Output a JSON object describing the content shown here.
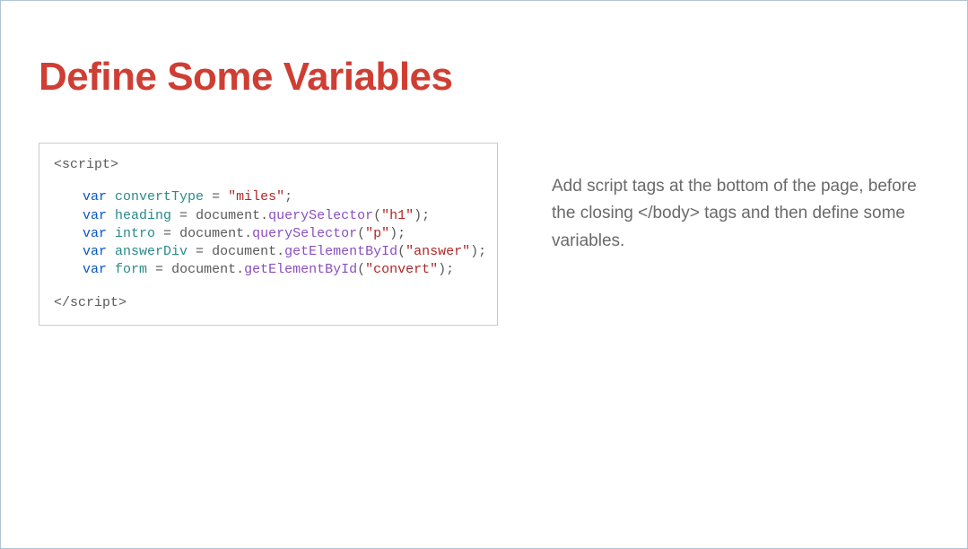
{
  "title": "Define Some Variables",
  "code": {
    "open": "<script>",
    "l1_kw": "var",
    "l1_name": "convertType",
    "l1_eq": " = ",
    "l1_str": "\"miles\"",
    "l1_end": ";",
    "l2_kw": "var",
    "l2_name": "heading",
    "l2_eq": " = ",
    "l2_obj": "document",
    "l2_dot": ".",
    "l2_meth": "querySelector",
    "l2_open": "(",
    "l2_str": "\"h1\"",
    "l2_close": ");",
    "l3_kw": "var",
    "l3_name": "intro",
    "l3_eq": " = ",
    "l3_obj": "document",
    "l3_dot": ".",
    "l3_meth": "querySelector",
    "l3_open": "(",
    "l3_str": "\"p\"",
    "l3_close": ");",
    "l4_kw": "var",
    "l4_name": "answerDiv",
    "l4_eq": " = ",
    "l4_obj": "document",
    "l4_dot": ".",
    "l4_meth": "getElementById",
    "l4_open": "(",
    "l4_str": "\"answer\"",
    "l4_close": ");",
    "l5_kw": "var",
    "l5_name": "form",
    "l5_eq": " = ",
    "l5_obj": "document",
    "l5_dot": ".",
    "l5_meth": "getElementById",
    "l5_open": "(",
    "l5_str": "\"convert\"",
    "l5_close": ");",
    "close": "</script>"
  },
  "description": "Add script tags at the bottom of the page, before the closing </body> tags and then define some variables."
}
